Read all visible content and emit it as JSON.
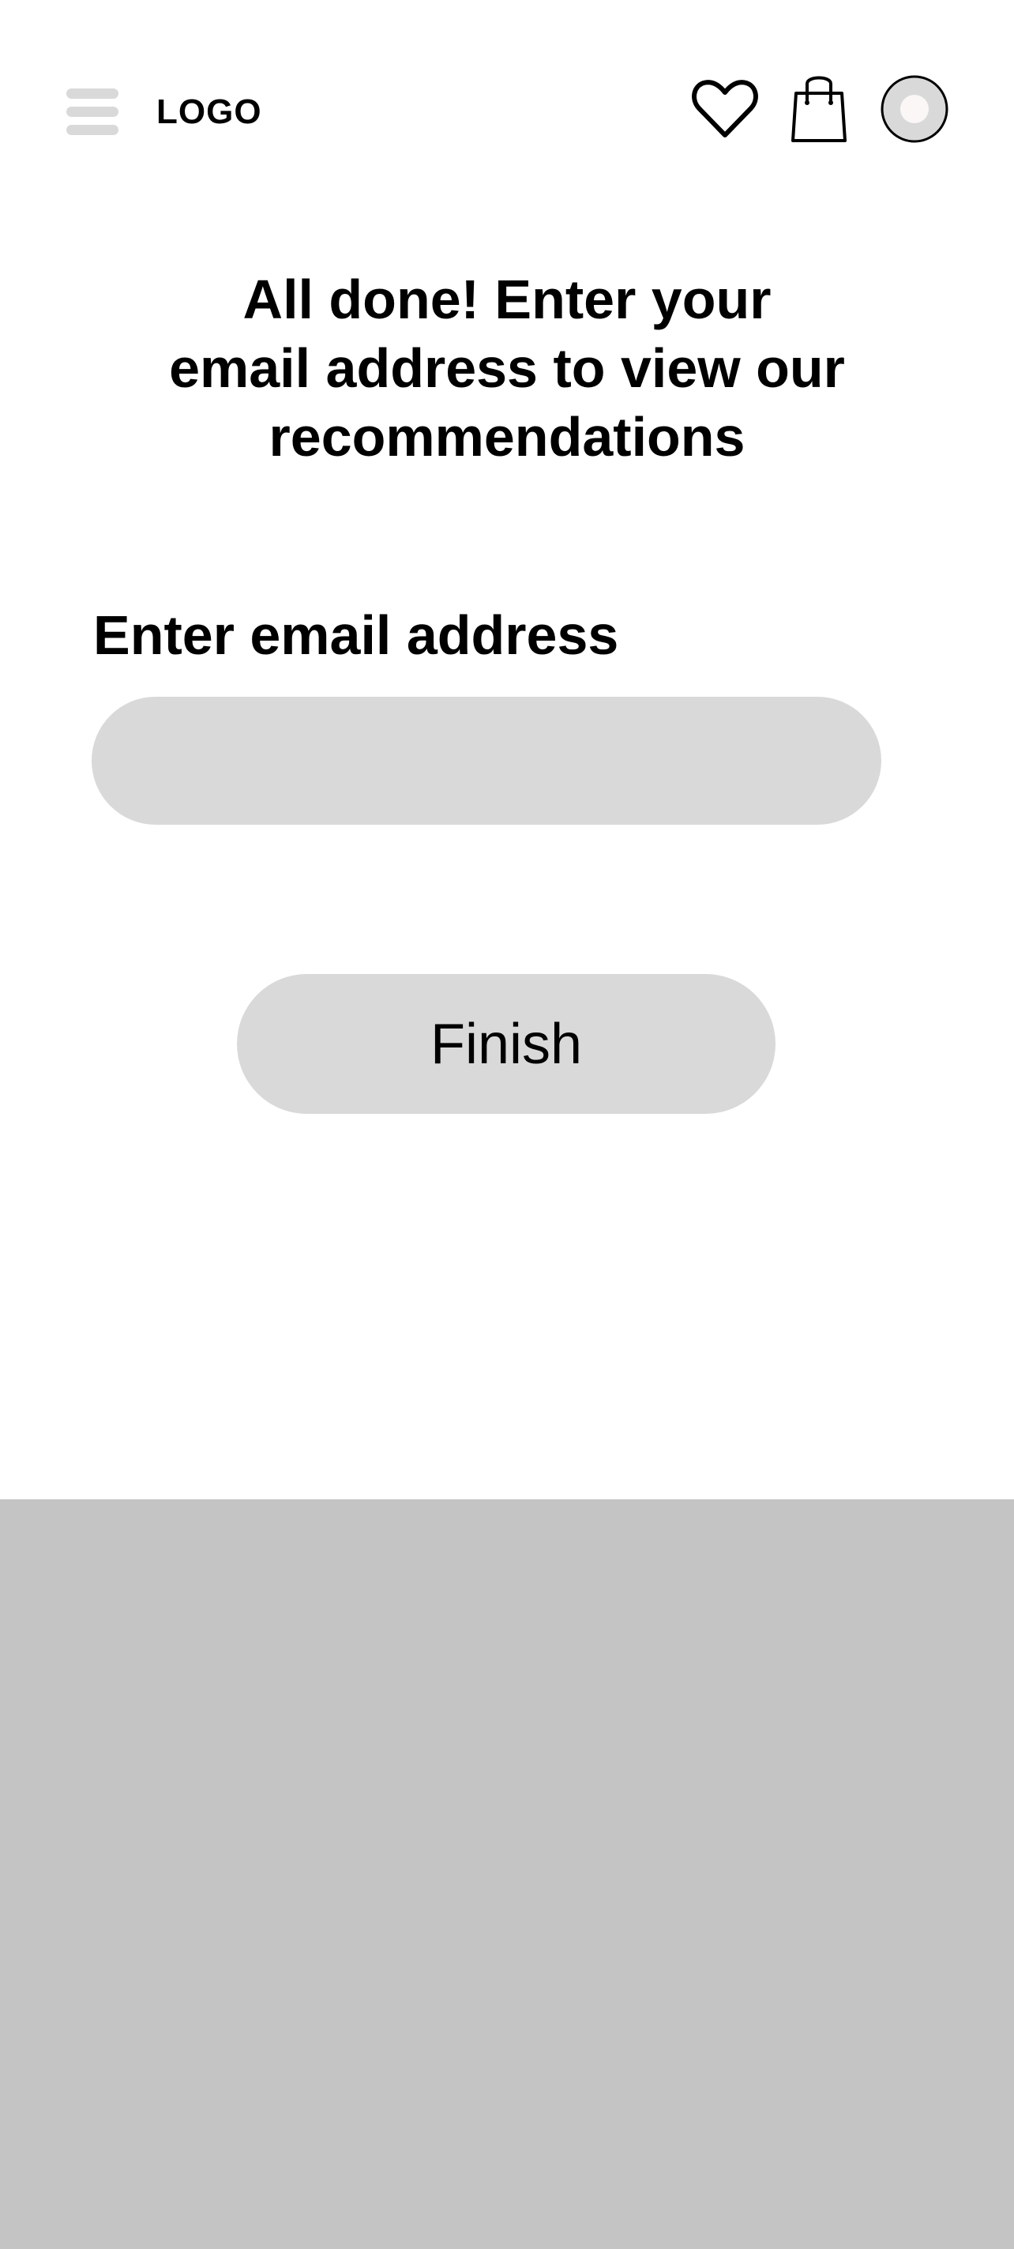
{
  "header": {
    "logo": "LOGO",
    "icons": [
      "menu-icon",
      "heart-icon",
      "shopping-bag-icon",
      "avatar"
    ]
  },
  "main": {
    "headline_lines": [
      "All done! Enter your",
      "email address to view our",
      "recommendations"
    ],
    "email_label": "Enter email address",
    "email_value": "",
    "email_placeholder": "",
    "finish_label": "Finish"
  },
  "colors": {
    "field_background": "#d9d9d9",
    "bottom_panel": "#c4c4c4",
    "text": "#000000"
  }
}
